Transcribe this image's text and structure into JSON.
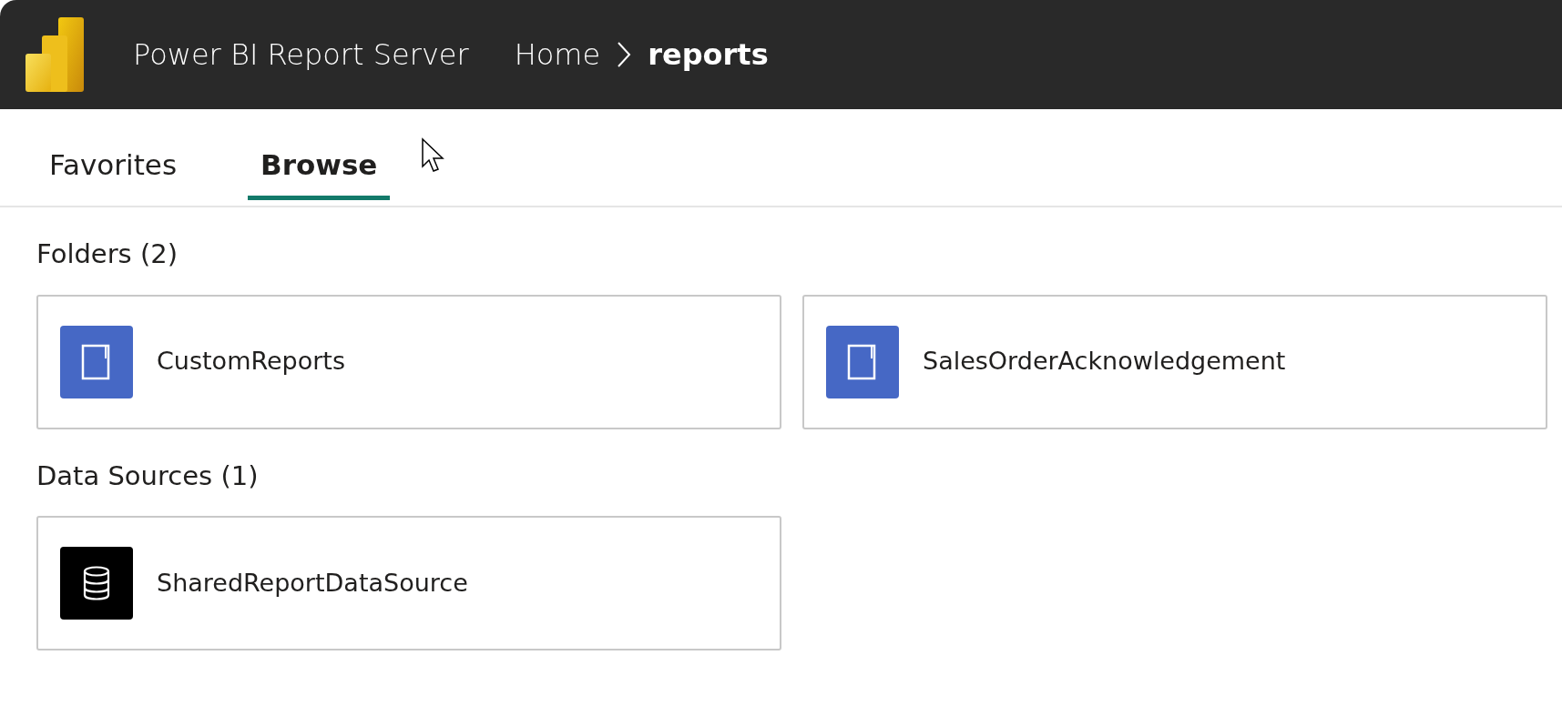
{
  "header": {
    "title": "Power BI Report Server",
    "breadcrumb": [
      {
        "label": "Home",
        "current": false
      },
      {
        "label": "reports",
        "current": true
      }
    ]
  },
  "tabs": [
    {
      "label": "Favorites",
      "selected": false
    },
    {
      "label": "Browse",
      "selected": true
    }
  ],
  "sections": [
    {
      "title": "Folders (2)",
      "items": [
        {
          "name": "CustomReports",
          "kind": "folder"
        },
        {
          "name": "SalesOrderAcknowledgement",
          "kind": "folder"
        }
      ]
    },
    {
      "title": "Data Sources (1)",
      "items": [
        {
          "name": "SharedReportDataSource",
          "kind": "datasource"
        }
      ]
    }
  ]
}
